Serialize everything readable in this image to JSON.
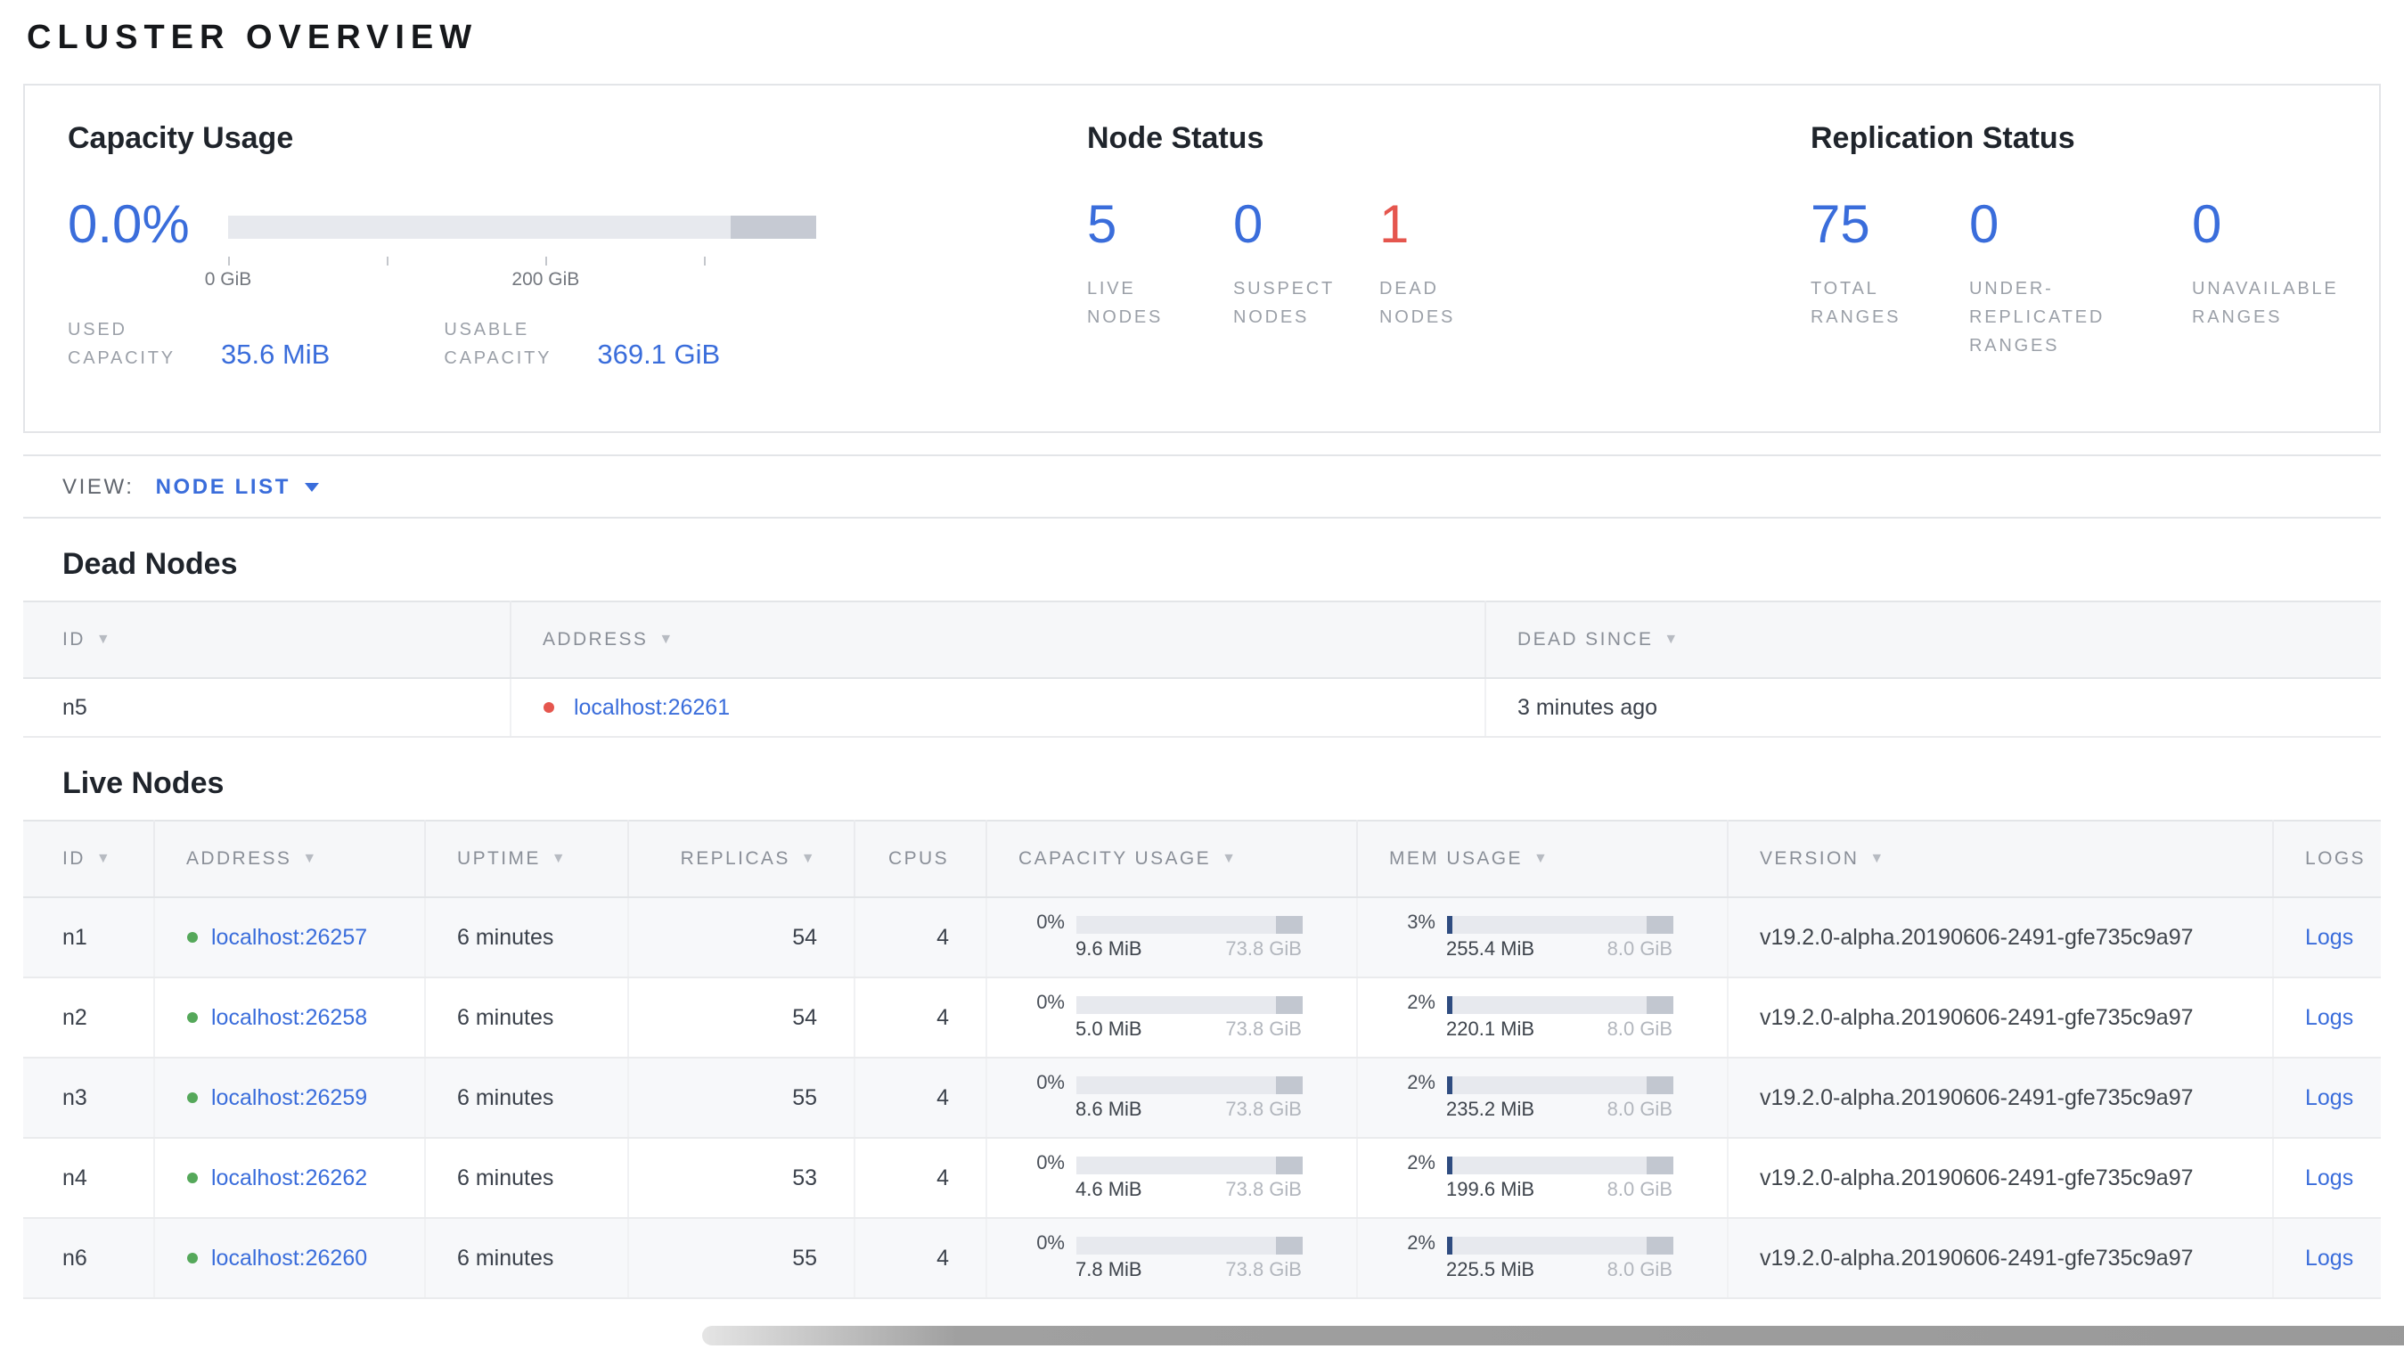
{
  "page_title": "CLUSTER OVERVIEW",
  "summary": {
    "capacity": {
      "title": "Capacity Usage",
      "percent": "0.0%",
      "tick_labels": [
        "0 GiB",
        "200 GiB"
      ],
      "used": {
        "label": "USED CAPACITY",
        "value": "35.6 MiB"
      },
      "usable": {
        "label": "USABLE CAPACITY",
        "value": "369.1 GiB"
      }
    },
    "node_status": {
      "title": "Node Status",
      "stats": [
        {
          "value": "5",
          "label": "LIVE NODES"
        },
        {
          "value": "0",
          "label": "SUSPECT NODES"
        },
        {
          "value": "1",
          "label": "DEAD NODES"
        }
      ]
    },
    "replication": {
      "title": "Replication Status",
      "stats": [
        {
          "value": "75",
          "label": "TOTAL RANGES"
        },
        {
          "value": "0",
          "label": "UNDER-REPLICATED RANGES"
        },
        {
          "value": "0",
          "label": "UNAVAILABLE RANGES"
        }
      ]
    }
  },
  "view_bar": {
    "label": "VIEW:",
    "selected": "NODE LIST"
  },
  "dead_nodes": {
    "title": "Dead Nodes",
    "columns": [
      {
        "label": "ID"
      },
      {
        "label": "ADDRESS"
      },
      {
        "label": "DEAD SINCE"
      }
    ],
    "rows": [
      {
        "id": "n5",
        "address": "localhost:26261",
        "dead_since": "3 minutes ago"
      }
    ]
  },
  "live_nodes": {
    "title": "Live Nodes",
    "columns": [
      {
        "label": "ID"
      },
      {
        "label": "ADDRESS"
      },
      {
        "label": "UPTIME"
      },
      {
        "label": "REPLICAS"
      },
      {
        "label": "CPUS"
      },
      {
        "label": "CAPACITY USAGE"
      },
      {
        "label": "MEM USAGE"
      },
      {
        "label": "VERSION"
      },
      {
        "label": "LOGS"
      }
    ],
    "rows": [
      {
        "id": "n1",
        "address": "localhost:26257",
        "uptime": "6 minutes",
        "replicas": "54",
        "cpus": "4",
        "capacity": {
          "pct": "0%",
          "used": "9.6 MiB",
          "total": "73.8 GiB"
        },
        "memory": {
          "pct": "3%",
          "used": "255.4 MiB",
          "total": "8.0 GiB"
        },
        "version": "v19.2.0-alpha.20190606-2491-gfe735c9a97",
        "logs": "Logs"
      },
      {
        "id": "n2",
        "address": "localhost:26258",
        "uptime": "6 minutes",
        "replicas": "54",
        "cpus": "4",
        "capacity": {
          "pct": "0%",
          "used": "5.0 MiB",
          "total": "73.8 GiB"
        },
        "memory": {
          "pct": "2%",
          "used": "220.1 MiB",
          "total": "8.0 GiB"
        },
        "version": "v19.2.0-alpha.20190606-2491-gfe735c9a97",
        "logs": "Logs"
      },
      {
        "id": "n3",
        "address": "localhost:26259",
        "uptime": "6 minutes",
        "replicas": "55",
        "cpus": "4",
        "capacity": {
          "pct": "0%",
          "used": "8.6 MiB",
          "total": "73.8 GiB"
        },
        "memory": {
          "pct": "2%",
          "used": "235.2 MiB",
          "total": "8.0 GiB"
        },
        "version": "v19.2.0-alpha.20190606-2491-gfe735c9a97",
        "logs": "Logs"
      },
      {
        "id": "n4",
        "address": "localhost:26262",
        "uptime": "6 minutes",
        "replicas": "53",
        "cpus": "4",
        "capacity": {
          "pct": "0%",
          "used": "4.6 MiB",
          "total": "73.8 GiB"
        },
        "memory": {
          "pct": "2%",
          "used": "199.6 MiB",
          "total": "8.0 GiB"
        },
        "version": "v19.2.0-alpha.20190606-2491-gfe735c9a97",
        "logs": "Logs"
      },
      {
        "id": "n6",
        "address": "localhost:26260",
        "uptime": "6 minutes",
        "replicas": "55",
        "cpus": "4",
        "capacity": {
          "pct": "0%",
          "used": "7.8 MiB",
          "total": "73.8 GiB"
        },
        "memory": {
          "pct": "2%",
          "used": "225.5 MiB",
          "total": "8.0 GiB"
        },
        "version": "v19.2.0-alpha.20190606-2491-gfe735c9a97",
        "logs": "Logs"
      }
    ]
  },
  "colors": {
    "accent_blue": "#3a6ddb",
    "danger_red": "#e5564e",
    "live_green": "#55a85a",
    "bar_track": "#e7e9ee",
    "bar_dark_segment": "#c6cad3",
    "mem_used_fill": "#2f4c80"
  }
}
